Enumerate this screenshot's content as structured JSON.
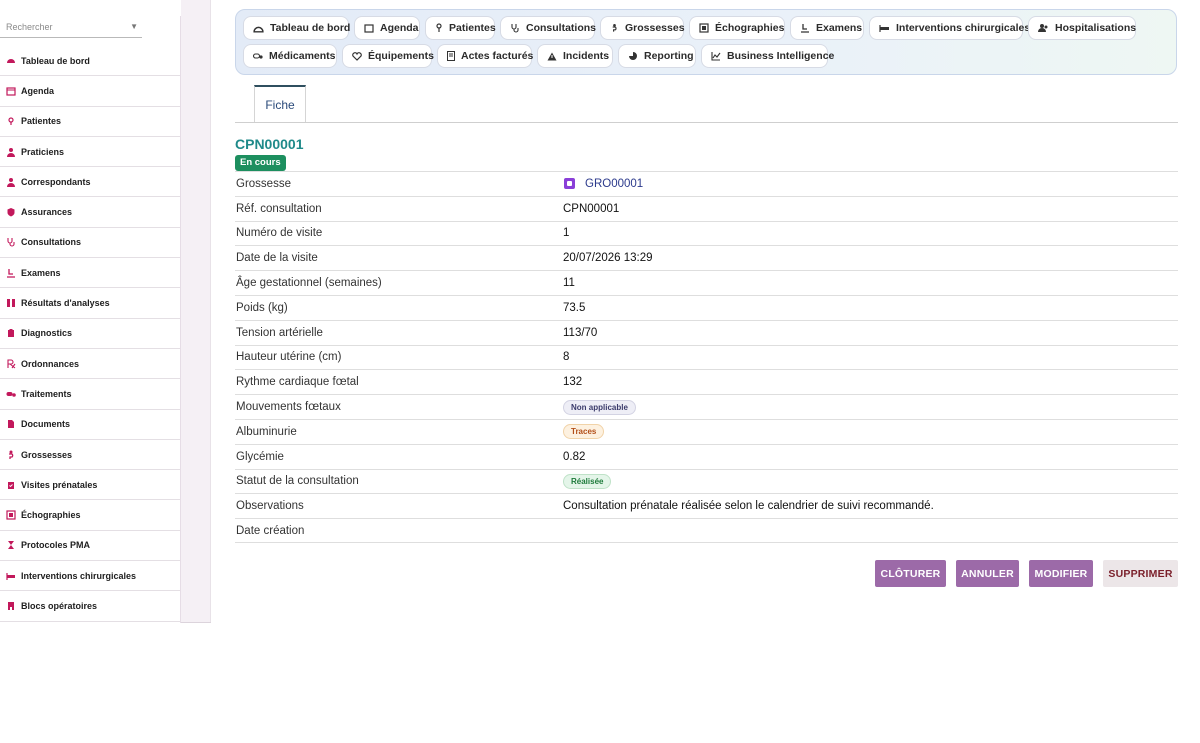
{
  "sidebar": {
    "search_placeholder": "Rechercher",
    "items": [
      {
        "label": "Tableau de bord",
        "icon": "dashboard-icon"
      },
      {
        "label": "Agenda",
        "icon": "calendar-icon"
      },
      {
        "label": "Patientes",
        "icon": "pin-icon"
      },
      {
        "label": "Praticiens",
        "icon": "doctor-icon"
      },
      {
        "label": "Correspondants",
        "icon": "person-icon"
      },
      {
        "label": "Assurances",
        "icon": "shield-icon"
      },
      {
        "label": "Consultations",
        "icon": "stethoscope-icon"
      },
      {
        "label": "Examens",
        "icon": "exam-icon"
      },
      {
        "label": "Résultats d'analyses",
        "icon": "lab-icon"
      },
      {
        "label": "Diagnostics",
        "icon": "clipboard-icon"
      },
      {
        "label": "Ordonnances",
        "icon": "prescription-icon"
      },
      {
        "label": "Traitements",
        "icon": "pills-icon"
      },
      {
        "label": "Documents",
        "icon": "document-icon"
      },
      {
        "label": "Grossesses",
        "icon": "pregnancy-icon"
      },
      {
        "label": "Visites prénatales",
        "icon": "clipboard-check-icon"
      },
      {
        "label": "Échographies",
        "icon": "ultrasound-icon"
      },
      {
        "label": "Protocoles PMA",
        "icon": "hourglass-icon"
      },
      {
        "label": "Interventions chirurgicales",
        "icon": "bed-icon"
      },
      {
        "label": "Blocs opératoires",
        "icon": "building-icon"
      }
    ]
  },
  "topnav": [
    {
      "label": "Tableau de bord",
      "icon": "dashboard-icon"
    },
    {
      "label": "Agenda",
      "icon": "calendar-icon"
    },
    {
      "label": "Patientes",
      "icon": "pin-icon"
    },
    {
      "label": "Consultations",
      "icon": "stethoscope-icon"
    },
    {
      "label": "Grossesses",
      "icon": "pregnancy-icon"
    },
    {
      "label": "Échographies",
      "icon": "ultrasound-icon"
    },
    {
      "label": "Examens",
      "icon": "exam-icon"
    },
    {
      "label": "Interventions chirurgicales",
      "icon": "bed-icon"
    },
    {
      "label": "Hospitalisations",
      "icon": "users-icon"
    },
    {
      "label": "Médicaments",
      "icon": "pills-icon"
    },
    {
      "label": "Équipements",
      "icon": "heart-icon"
    },
    {
      "label": "Actes facturés",
      "icon": "invoice-icon"
    },
    {
      "label": "Incidents",
      "icon": "warning-icon"
    },
    {
      "label": "Reporting",
      "icon": "pie-icon"
    },
    {
      "label": "Business Intelligence",
      "icon": "chart-icon"
    }
  ],
  "tabs": {
    "fiche": "Fiche"
  },
  "record": {
    "code": "CPN00001",
    "status": "En cours",
    "fields": [
      {
        "label": "Grossesse",
        "value": "GRO00001"
      },
      {
        "label": "Réf. consultation",
        "value": "CPN00001"
      },
      {
        "label": "Numéro de visite",
        "value": "1"
      },
      {
        "label": "Date de la visite",
        "value": "20/07/2026 13:29"
      },
      {
        "label": "Âge gestationnel (semaines)",
        "value": "11"
      },
      {
        "label": "Poids (kg)",
        "value": "73.5"
      },
      {
        "label": "Tension artérielle",
        "value": "113/70"
      },
      {
        "label": "Hauteur utérine (cm)",
        "value": "8"
      },
      {
        "label": "Rythme cardiaque fœtal",
        "value": "132"
      },
      {
        "label": "Mouvements fœtaux",
        "value": "Non applicable"
      },
      {
        "label": "Albuminurie",
        "value": "Traces"
      },
      {
        "label": "Glycémie",
        "value": "0.82"
      },
      {
        "label": "Statut de la consultation",
        "value": "Réalisée"
      },
      {
        "label": "Observations",
        "value": "Consultation prénatale réalisée selon le calendrier de suivi recommandé."
      },
      {
        "label": "Date création",
        "value": ""
      }
    ]
  },
  "actions": {
    "close": "CLÔTURER",
    "cancel": "ANNULER",
    "edit": "MODIFIER",
    "delete": "SUPPRIMER"
  },
  "colors": {
    "accent": "#9c6aa8",
    "title": "#1f8a8a",
    "status": "#1d8f5f",
    "sidebar_icon": "#c2185b"
  }
}
